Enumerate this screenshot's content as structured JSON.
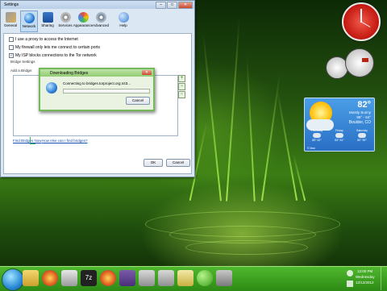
{
  "settings_window": {
    "title": "Settings",
    "toolbar": [
      {
        "label": "General",
        "icon": "tools-icon"
      },
      {
        "label": "Network",
        "icon": "globe-icon"
      },
      {
        "label": "Sharing",
        "icon": "flag-icon"
      },
      {
        "label": "Services",
        "icon": "gears-icon"
      },
      {
        "label": "Appearance",
        "icon": "palette-icon"
      },
      {
        "label": "Advanced",
        "icon": "cog-icon"
      },
      {
        "label": "Help",
        "icon": "help-icon"
      }
    ],
    "options": [
      {
        "label": "I use a proxy to access the Internet",
        "checked": false
      },
      {
        "label": "My firewall only lets me connect to certain ports",
        "checked": false
      },
      {
        "label": "My ISP blocks connections to the Tor network",
        "checked": true
      }
    ],
    "bridge_settings_label": "Bridge Settings",
    "add_bridge_label": "Add a Bridge:",
    "find_bridges_link": "Find Bridges Now",
    "how_else_link": "How else can I find bridges?",
    "ok_label": "OK",
    "cancel_label": "Cancel"
  },
  "dialog": {
    "title": "Downloading Bridges",
    "message": "Connecting to bridges.torproject.org:443...",
    "cancel_label": "Cancel"
  },
  "weather": {
    "temp": "82°",
    "condition": "Mostly Sunny",
    "hi_lo": "88° - 64°",
    "location": "Boulder, CO",
    "source": "© Msn",
    "forecast": [
      {
        "day": "Thursday",
        "temps": "85° 62°"
      },
      {
        "day": "Friday",
        "temps": "83° 61°"
      },
      {
        "day": "Saturday",
        "temps": "80° 59°"
      }
    ]
  },
  "taskbar": {
    "time": "12:00 PM",
    "day": "Wednesday",
    "date": "12/12/2012"
  },
  "colors": {
    "accent": "#2d8a14",
    "link": "#1a4fb0",
    "dialog_border": "#76b95a"
  }
}
